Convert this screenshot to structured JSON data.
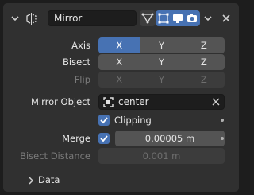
{
  "modifier": {
    "name": "Mirror",
    "icons": [
      "collapse-chevron-icon",
      "mirror-modifier-icon",
      "edit-cage-icon",
      "edit-mode-icon",
      "realtime-icon",
      "render-icon",
      "dropdown-icon",
      "close-icon"
    ]
  },
  "axis": {
    "label": "Axis",
    "options": [
      "X",
      "Y",
      "Z"
    ],
    "active": [
      "X"
    ]
  },
  "bisect": {
    "label": "Bisect",
    "options": [
      "X",
      "Y",
      "Z"
    ],
    "active": []
  },
  "flip": {
    "label": "Flip",
    "options": [
      "X",
      "Y",
      "Z"
    ],
    "active": []
  },
  "mirror_object": {
    "label": "Mirror Object",
    "value": "center",
    "icon": "object-icon"
  },
  "clipping": {
    "label": "Clipping",
    "checked": true
  },
  "merge": {
    "label": "Merge",
    "checked": true,
    "value": "0.00005 m"
  },
  "bisect_distance": {
    "label": "Bisect Distance",
    "value": "0.001 m"
  },
  "data_panel": {
    "label": "Data",
    "expanded": false
  },
  "colors": {
    "accent": "#4772b3",
    "panel": "#303030",
    "background": "#1d1d1d"
  }
}
